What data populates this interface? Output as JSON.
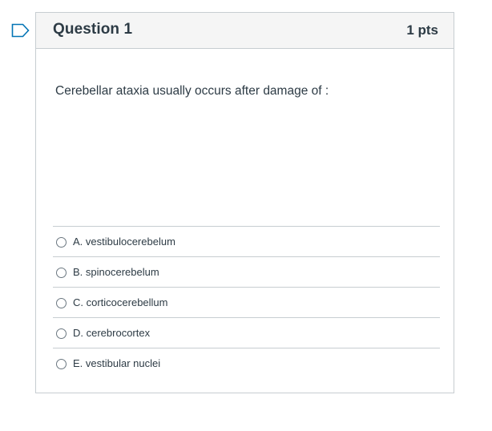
{
  "question": {
    "title": "Question 1",
    "points": "1 pts",
    "text": "Cerebellar ataxia usually occurs after damage of :",
    "answers": [
      {
        "label": "A. vestibulocerebelum"
      },
      {
        "label": "B. spinocerebelum"
      },
      {
        "label": "C. corticocerebellum"
      },
      {
        "label": "D. cerebrocortex"
      },
      {
        "label": "E. vestibular nuclei"
      }
    ]
  },
  "colors": {
    "flag": "#0374b5",
    "border": "#c7cdd1",
    "header_bg": "#f5f5f5",
    "text": "#2d3b45"
  },
  "icons": {
    "flag": "flag-icon"
  }
}
